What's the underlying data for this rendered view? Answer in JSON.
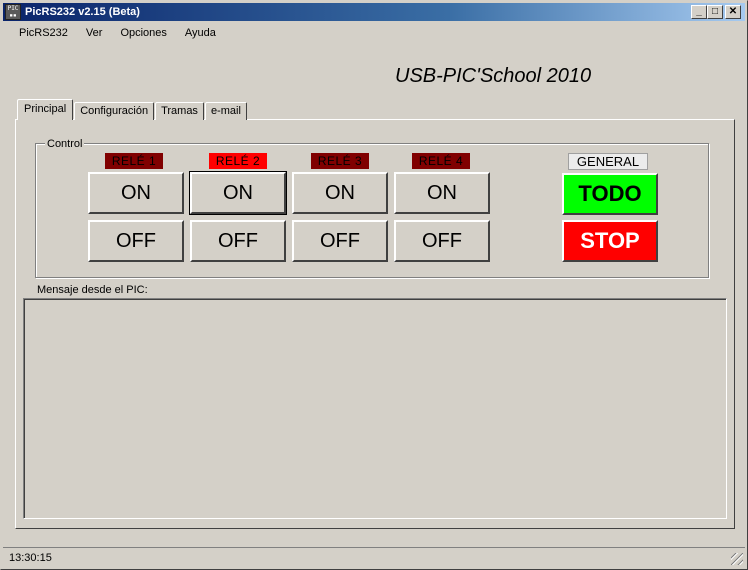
{
  "window": {
    "title": "PicRS232 v2.15 (Beta)",
    "minimize": "_",
    "maximize": "□",
    "close": "✕",
    "icon": "pic-app-icon"
  },
  "menu": [
    "PicRS232",
    "Ver",
    "Opciones",
    "Ayuda"
  ],
  "brand": "USB-PIC'School 2010",
  "tabs": [
    "Principal",
    "Configuración",
    "Tramas",
    "e-mail"
  ],
  "control": {
    "group_label": "Control",
    "relays": [
      {
        "label": "RELÉ 1",
        "on": "ON",
        "off": "OFF",
        "state_color": "#800000"
      },
      {
        "label": "RELÉ 2",
        "on": "ON",
        "off": "OFF",
        "state_color": "#ff0000"
      },
      {
        "label": "RELÉ 3",
        "on": "ON",
        "off": "OFF",
        "state_color": "#800000"
      },
      {
        "label": "RELÉ 4",
        "on": "ON",
        "off": "OFF",
        "state_color": "#800000"
      }
    ],
    "general_label": "GENERAL",
    "all_button": "TODO",
    "stop_button": "STOP",
    "colors": {
      "todo": "#00ff00",
      "stop": "#ff0000"
    }
  },
  "message": {
    "label": "Mensaje desde el PIC:",
    "value": ""
  },
  "status": {
    "time": "13:30:15"
  }
}
